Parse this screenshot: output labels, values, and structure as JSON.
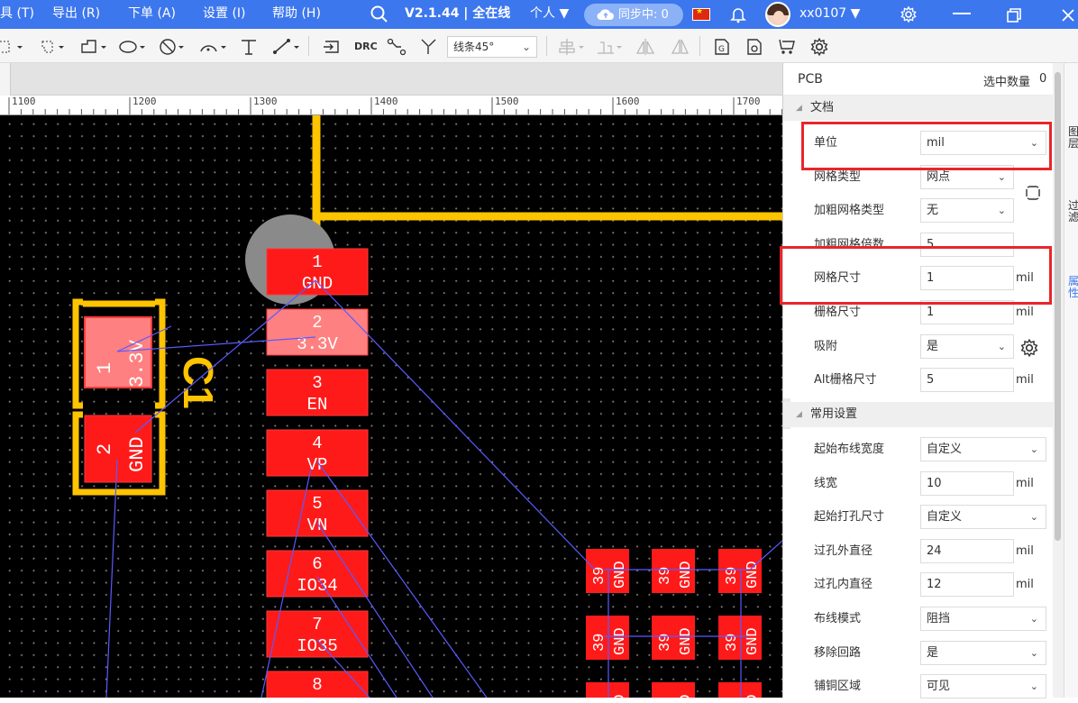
{
  "menubar": {
    "items": [
      "具 (T)",
      "导出 (R)",
      "下单 (A)",
      "设置 (I)",
      "帮助 (H)"
    ],
    "version_label": "V2.1.44 | 全在线",
    "workspace": "个人",
    "sync_label": "同步中: 0",
    "username": "xx0107"
  },
  "toolbar": {
    "drc_label": "DRC",
    "line_mode": "线条45°"
  },
  "ruler": {
    "labels": [
      "1100",
      "1200",
      "1300",
      "1400",
      "1500",
      "1600",
      "1700"
    ]
  },
  "pcb": {
    "c1_label": "C1",
    "c1_pads": [
      {
        "num": "1",
        "net": "3.3V"
      },
      {
        "num": "2",
        "net": "GND"
      }
    ],
    "module_pads": [
      {
        "num": "1",
        "net": "GND"
      },
      {
        "num": "2",
        "net": "3.3V"
      },
      {
        "num": "3",
        "net": "EN"
      },
      {
        "num": "4",
        "net": "VP"
      },
      {
        "num": "5",
        "net": "VN"
      },
      {
        "num": "6",
        "net": "IO34"
      },
      {
        "num": "7",
        "net": "IO35"
      },
      {
        "num": "8",
        "net": ""
      }
    ],
    "small_pads": [
      {
        "num": "39",
        "net": "GND"
      }
    ]
  },
  "panel": {
    "title": "PCB",
    "selected_count_label": "选中数量",
    "selected_count": "0",
    "section_doc": "文档",
    "section_common": "常用设置",
    "doc_rows": [
      {
        "label": "单位",
        "value": "mil",
        "type": "select"
      },
      {
        "label": "网格类型",
        "value": "网点",
        "type": "select"
      },
      {
        "label": "加粗网格类型",
        "value": "无",
        "type": "select"
      },
      {
        "label": "加粗网格倍数",
        "value": "5",
        "type": "input"
      },
      {
        "label": "网格尺寸",
        "value": "1",
        "unit": "mil",
        "type": "input"
      },
      {
        "label": "栅格尺寸",
        "value": "1",
        "unit": "mil",
        "type": "input"
      },
      {
        "label": "吸附",
        "value": "是",
        "type": "select"
      },
      {
        "label": "Alt栅格尺寸",
        "value": "5",
        "unit": "mil",
        "type": "input"
      }
    ],
    "common_rows": [
      {
        "label": "起始布线宽度",
        "value": "自定义",
        "type": "select"
      },
      {
        "label": "线宽",
        "value": "10",
        "unit": "mil",
        "type": "input"
      },
      {
        "label": "起始打孔尺寸",
        "value": "自定义",
        "type": "select"
      },
      {
        "label": "过孔外直径",
        "value": "24",
        "unit": "mil",
        "type": "input"
      },
      {
        "label": "过孔内直径",
        "value": "12",
        "unit": "mil",
        "type": "input"
      },
      {
        "label": "布线模式",
        "value": "阻挡",
        "type": "select"
      },
      {
        "label": "移除回路",
        "value": "是",
        "type": "select"
      },
      {
        "label": "铺铜区域",
        "value": "可见",
        "type": "select"
      }
    ]
  },
  "dock": {
    "tabs": [
      "图层",
      "过滤",
      "属性"
    ]
  },
  "colors": {
    "menubar": "#3d77ee",
    "pad": "#ff1a1a",
    "pad_selected": "#ff8080",
    "track": "#ffc400",
    "ratline": "#5a5aff",
    "highlight": "#e8262b"
  }
}
